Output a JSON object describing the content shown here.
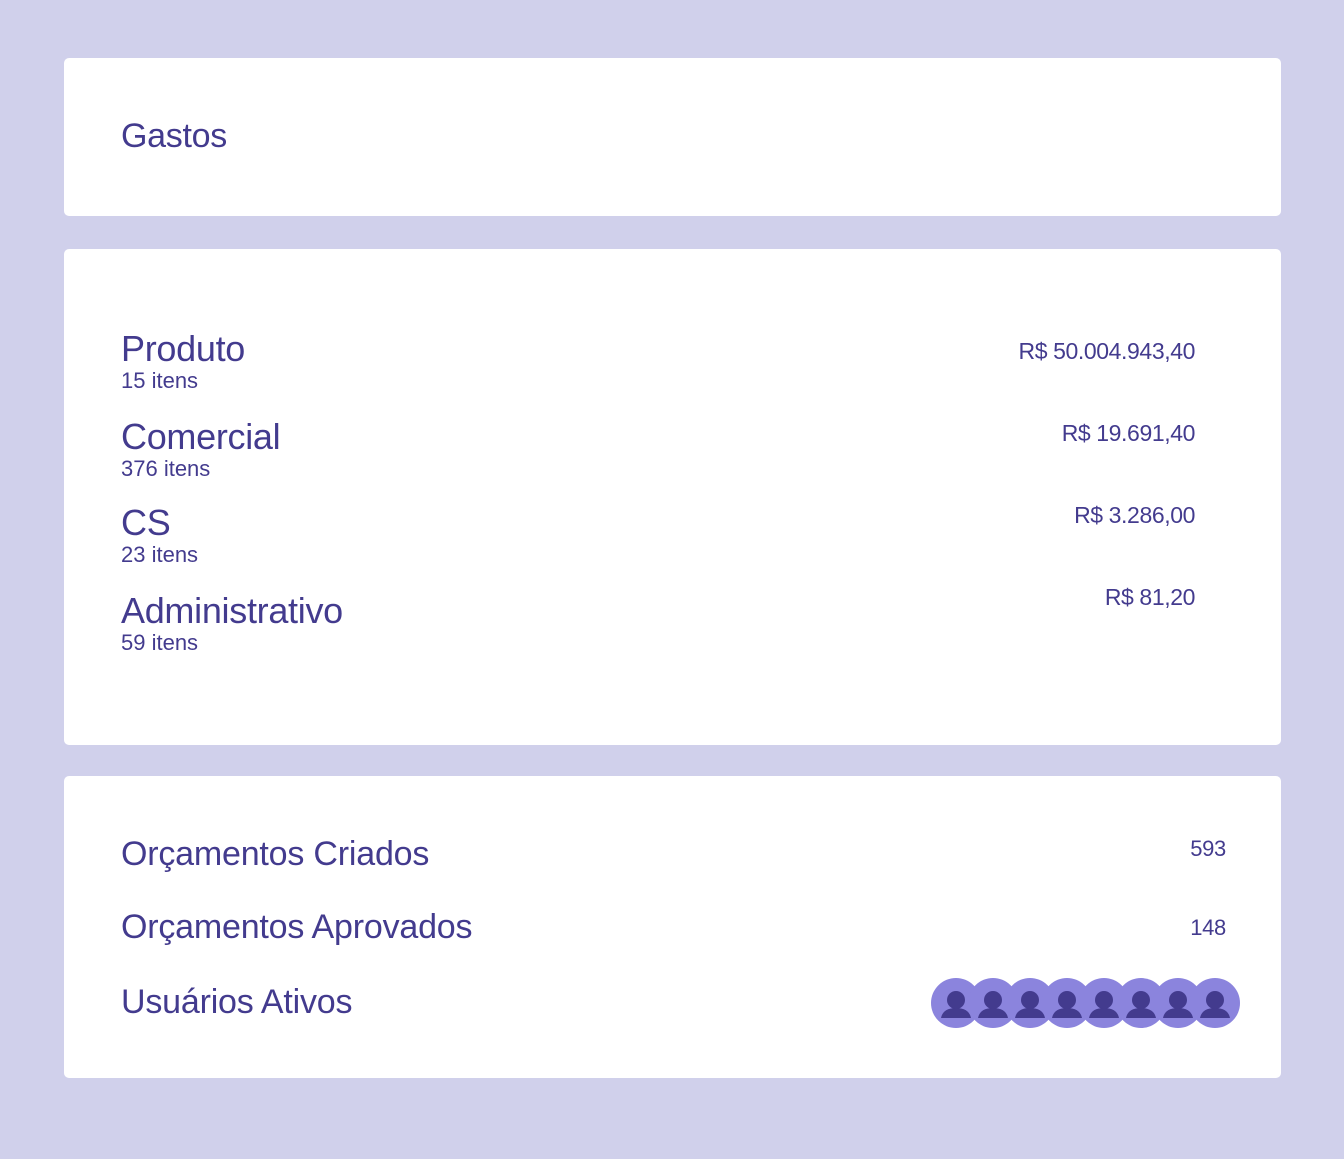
{
  "gastos": {
    "title": "Gastos"
  },
  "categories": [
    {
      "name": "Produto",
      "count": "15 itens",
      "amount": "R$ 50.004.943,40"
    },
    {
      "name": "Comercial",
      "count": "376 itens",
      "amount": "R$ 19.691,40"
    },
    {
      "name": "CS",
      "count": "23 itens",
      "amount": "R$ 3.286,00"
    },
    {
      "name": "Administrativo",
      "count": "59 itens",
      "amount": "R$ 81,20"
    }
  ],
  "stats": {
    "created_label": "Orçamentos Criados",
    "created_value": "593",
    "approved_label": "Orçamentos Aprovados",
    "approved_value": "148",
    "active_users_label": "Usuários Ativos",
    "active_users_avatar_count": 8
  },
  "colors": {
    "background": "#d0d0eb",
    "card": "#ffffff",
    "text": "#433b8e",
    "avatar_bg": "#8b84dd",
    "avatar_figure": "#433b8e"
  }
}
